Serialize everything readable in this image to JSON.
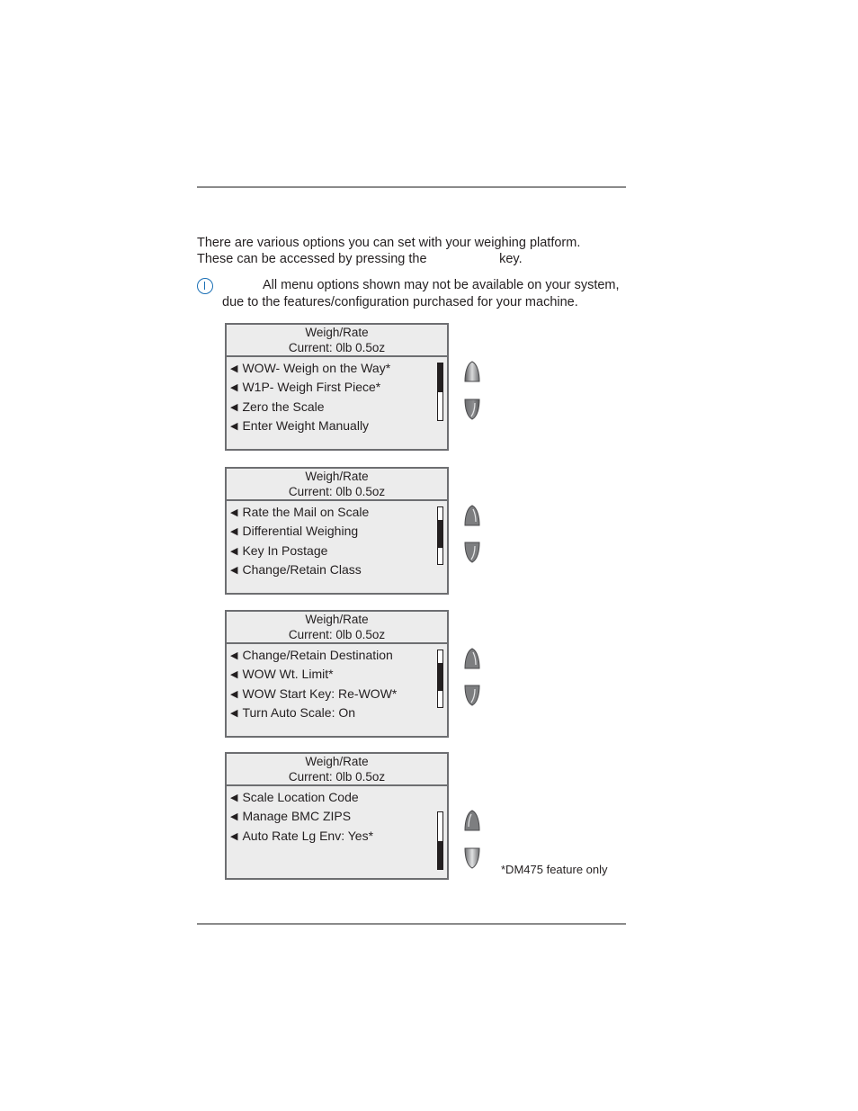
{
  "intro": {
    "line1": "There are various options you can set with your weighing platform.",
    "line2": "These can be accessed by pressing the                    key."
  },
  "note": {
    "icon": "info-icon",
    "line1": "All menu options shown may not be available on your system,",
    "line2": "due to the features/configuration purchased for your machine."
  },
  "screens": [
    {
      "title": "Weigh/Rate",
      "current": "Current:  0lb 0.5oz",
      "items": [
        "WOW- Weigh on the Way*",
        "W1P- Weigh First Piece*",
        "Zero the Scale",
        "Enter Weight Manually"
      ],
      "scroll_position": {
        "start": 0.0,
        "end": 0.5
      }
    },
    {
      "title": "Weigh/Rate",
      "current": "Current:  0lb 0.5oz",
      "items": [
        "Rate the Mail on Scale",
        "Differential Weighing",
        "Key In Postage",
        "Change/Retain Class"
      ],
      "scroll_position": {
        "start": 0.22,
        "end": 0.72
      }
    },
    {
      "title": "Weigh/Rate",
      "current": "Current:  0lb 0.5oz",
      "items": [
        "Change/Retain Destination",
        "WOW Wt. Limit*",
        "WOW Start Key: Re-WOW*",
        "Turn Auto Scale: On"
      ],
      "scroll_position": {
        "start": 0.22,
        "end": 0.72
      }
    },
    {
      "title": "Weigh/Rate",
      "current": "Current:  0lb 0.5oz",
      "items": [
        "Scale Location Code",
        "Manage BMC ZIPS",
        "Auto Rate Lg Env:  Yes*"
      ],
      "scroll_position": {
        "start": 0.5,
        "end": 1.0
      }
    }
  ],
  "nav": {
    "up_icon": "scroll-up-key-icon",
    "down_icon": "scroll-down-key-icon"
  },
  "footnote": "*DM475 feature only"
}
